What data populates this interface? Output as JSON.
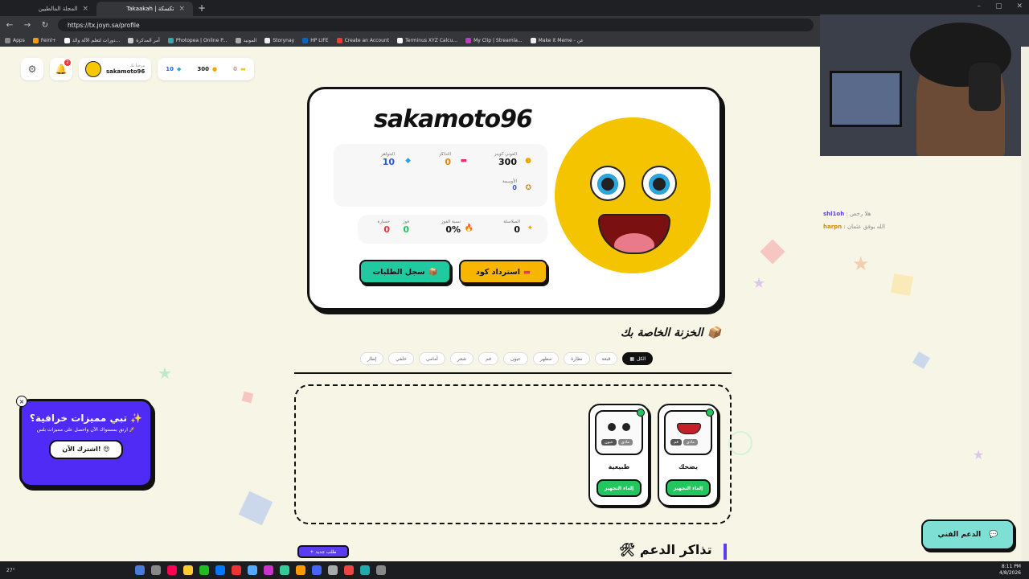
{
  "browser": {
    "tabs": [
      {
        "title": "المجلة المالطيين",
        "active": false
      },
      {
        "title": "Takaakah | تكسكة",
        "active": true
      }
    ],
    "url": "https://tx.joyn.sa/profile",
    "bookmarks": [
      "Apps",
      "Feinl+",
      "دورات لتعلم الآلة والذ...",
      "أمر المدكرة",
      "Photopea | Online P...",
      "المونيد",
      "Storynay",
      "HP LIFE",
      "Create an Account",
      "Terminus XYZ Calcu...",
      "My Clip | Streamla...",
      "Make it Meme - عن"
    ]
  },
  "header": {
    "greeting": "مرحبا بك",
    "username": "sakamoto96",
    "notifications_count": "2",
    "gems": "10",
    "coins": "300",
    "tickets": "0"
  },
  "profile": {
    "name": "sakamoto96",
    "stats": {
      "coins_label": "العوني كوينز",
      "coins_value": "300",
      "tickets_label": "التذاكر",
      "tickets_value": "0",
      "gems_label": "الجواهر",
      "gems_value": "10",
      "medals_label": "الأوسمة",
      "medals_value": "0",
      "streak_label": "السلاسلة",
      "streak_value": "0",
      "winrate_label": "نسبة الفوز",
      "winrate_value": "0%",
      "wins_label": "فوز",
      "wins_value": "0",
      "losses_label": "خسارة",
      "losses_value": "0"
    },
    "redeem_button": "استرداد كود",
    "orders_button": "سجل الطلبات"
  },
  "vault": {
    "title": "الخزنة الخاصة بك",
    "categories": [
      "الكل",
      "قبعة",
      "نظارة",
      "مظهر",
      "عيون",
      "فم",
      "شعر",
      "أمامي",
      "خلفي",
      "إطار"
    ],
    "items": [
      {
        "name": "يضحك",
        "action": "إلغاء التجهيز",
        "tags": [
          "فم",
          "مادي"
        ]
      },
      {
        "name": "طبيعية",
        "action": "إلغاء التجهيز",
        "tags": [
          "عيون",
          "مادي"
        ]
      }
    ]
  },
  "tickets": {
    "title": "تذاكر الدعم",
    "new_order_button": "+ طلب جديد"
  },
  "promo": {
    "title": "تبي مميزات خرافية؟ ✨",
    "description": "ارتق بمستواك الآن واحصل على مميزات بلس 🚀",
    "button": "اشترك الآن! 😍"
  },
  "support_button": "الدعم الفني",
  "chat": [
    {
      "user": "shl1oh",
      "message": "هلا رخص"
    },
    {
      "user": "harpn",
      "message": "الله يوفق عثمان"
    }
  ],
  "taskbar": {
    "weather": "27°",
    "time": "8:11 PM",
    "date": "4/8/2026"
  },
  "colors": {
    "accent": "#5a3df0",
    "gold": "#f7b500",
    "teal": "#20c9a0",
    "green": "#22c55e",
    "page_bg": "#f7f5e6"
  }
}
